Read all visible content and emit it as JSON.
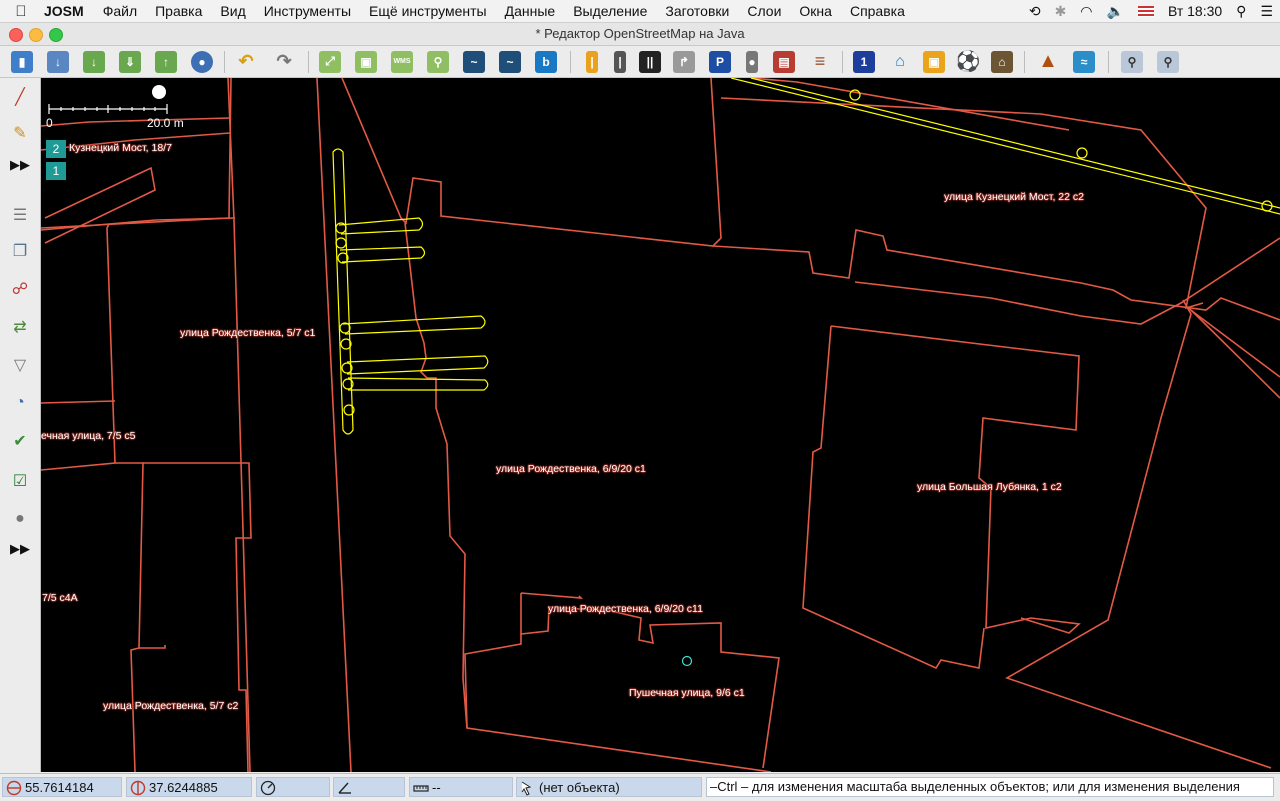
{
  "menubar": {
    "app": "JOSM",
    "items": [
      "Файл",
      "Правка",
      "Вид",
      "Инструменты",
      "Ещё инструменты",
      "Данные",
      "Выделение",
      "Заготовки",
      "Слои",
      "Окна",
      "Справка"
    ],
    "clock": "Вт 18:30"
  },
  "window": {
    "title": "* Редактор OpenStreetMap на Java"
  },
  "map": {
    "scale_left": "0",
    "scale_right": "20.0 m",
    "layers": [
      "2",
      "1"
    ],
    "labels": [
      "Кузнецкий Мост, 18/7",
      "улица Кузнецкий Мост, 22 с2",
      "улица Рождественка, 5/7 с1",
      "ечная улица, 7/5 с5",
      "улица Рождественка, 6/9/20 с1",
      "улица Большая Лубянка, 1 с2",
      "7/5 с4А",
      "улица Рождественка, 6/9/20 с11",
      "Пушечная улица, 9/6 с1",
      "улица Рождественка, 5/7 с2"
    ]
  },
  "statusbar": {
    "lat": "55.7614184",
    "lon": "37.6244885",
    "heading": "",
    "angle": "",
    "distance": "--",
    "object": "(нет объекта)",
    "hint": "–Ctrl – для изменения масштаба выделенных объектов; или для изменения выделения"
  },
  "colors": {
    "building": "#e25a45",
    "way": "#ffff00",
    "badge": "#1e9b97"
  }
}
